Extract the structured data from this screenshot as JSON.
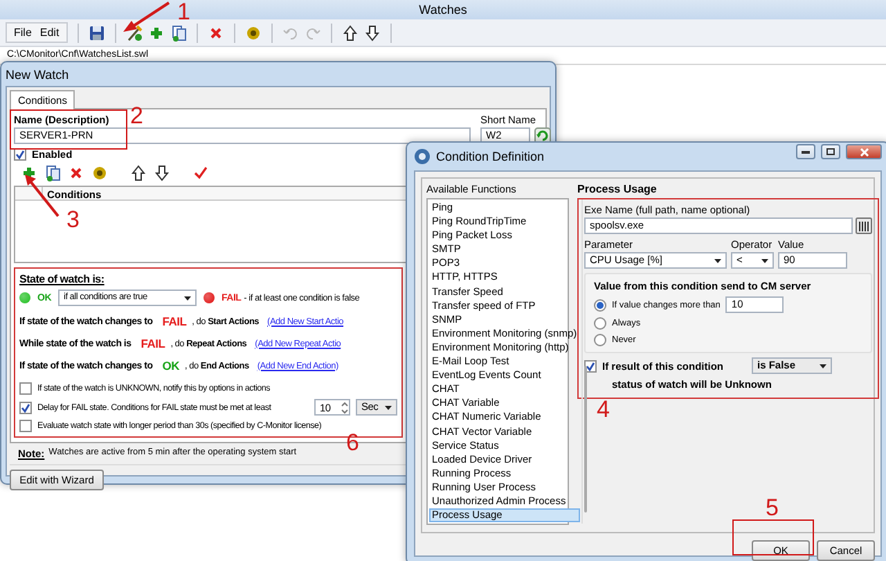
{
  "app": {
    "title": "Watches",
    "menu": [
      "File",
      "Edit"
    ],
    "path": "C:\\CMonitor\\Cnf\\WatchesList.swl"
  },
  "new_watch": {
    "title": "New Watch",
    "tabs": [
      {
        "label": "Conditions",
        "selected": true
      }
    ],
    "name_label": "Name (Description)",
    "name_value": "SERVER1-PRN",
    "short_name_label": "Short Name",
    "short_name_value": "W2",
    "enabled": {
      "label": "Enabled",
      "checked": true
    },
    "table": {
      "columns": [
        "Conditions"
      ]
    },
    "state": {
      "title": "State of watch is:",
      "ok_label": "OK",
      "ok_rule": "if all conditions are true",
      "fail_label": "FAIL",
      "fail_rule": "- if at least one condition is false",
      "actions": [
        {
          "lead": "If state of the watch changes to",
          "state": "FAIL",
          "kind": "fail",
          "tail": ", do **Start Actions**",
          "link": "(Add New Start Actio"
        },
        {
          "lead": "While state of the watch is",
          "state": "FAIL",
          "kind": "fail",
          "tail": ", do **Repeat Actions**",
          "link": "(Add New Repeat Actio"
        },
        {
          "lead": "If state of the watch changes to",
          "state": "OK",
          "kind": "ok",
          "tail": ", do **End Actions**",
          "link": "(Add New End Action)"
        }
      ],
      "options": [
        {
          "label": "If state of the watch is UNKNOWN, notify this by options in actions",
          "checked": false
        },
        {
          "label": "Delay for FAIL state. Conditions for FAIL state must be met at least",
          "checked": true,
          "value": "10",
          "unit": "Sec"
        },
        {
          "label": "Evaluate watch state with longer period than 30s (specified by C-Monitor license)",
          "checked": false
        }
      ]
    },
    "note_label": "Note:",
    "note_text": "Watches are active from 5 min after the operating system start",
    "wizard_button": "Edit with Wizard"
  },
  "condition": {
    "title": "Condition Definition",
    "functions_label": "Available Functions",
    "functions": [
      {
        "label": "Ping",
        "selected": false
      },
      {
        "label": "Ping RoundTripTime",
        "selected": false
      },
      {
        "label": "Ping Packet Loss",
        "selected": false
      },
      {
        "label": "SMTP",
        "selected": false
      },
      {
        "label": "POP3",
        "selected": false
      },
      {
        "label": "HTTP, HTTPS",
        "selected": false
      },
      {
        "label": "Transfer Speed",
        "selected": false
      },
      {
        "label": "Transfer speed of FTP",
        "selected": false
      },
      {
        "label": "SNMP",
        "selected": false
      },
      {
        "label": "Environment Monitoring (snmp)",
        "selected": false
      },
      {
        "label": "Environment Monitoring (http)",
        "selected": false
      },
      {
        "label": "E-Mail Loop Test",
        "selected": false
      },
      {
        "label": "EventLog Events Count",
        "selected": false
      },
      {
        "label": "CHAT",
        "selected": false
      },
      {
        "label": "CHAT Variable",
        "selected": false
      },
      {
        "label": "CHAT Numeric Variable",
        "selected": false
      },
      {
        "label": "CHAT Vector Variable",
        "selected": false
      },
      {
        "label": "Service Status",
        "selected": false
      },
      {
        "label": "Loaded Device Driver",
        "selected": false
      },
      {
        "label": "Running Process",
        "selected": false
      },
      {
        "label": "Running User Process",
        "selected": false
      },
      {
        "label": "Unauthorized Admin Process",
        "selected": false
      },
      {
        "label": "Process Usage",
        "selected": true
      }
    ],
    "section_title": "Process Usage",
    "exe_label": "Exe Name (full path, name optional)",
    "exe_value": "spoolsv.exe",
    "parameter_label": "Parameter",
    "parameter_value": "CPU Usage [%]",
    "operator_label": "Operator",
    "operator_value": "<",
    "value_label": "Value",
    "value_value": "90",
    "send_title": "Value from this condition send to CM server",
    "send_options": [
      {
        "label": "If value changes more than",
        "selected": true,
        "value": "10"
      },
      {
        "label": "Always",
        "selected": false
      },
      {
        "label": "Never",
        "selected": false
      }
    ],
    "unknown": {
      "checked": true,
      "label": "If result of this condition",
      "select": "is False",
      "tail": "status of watch will be Unknown"
    },
    "buttons": [
      "OK",
      "Cancel"
    ]
  },
  "annotations": [
    {
      "label": "1"
    },
    {
      "label": "2"
    },
    {
      "label": "3"
    },
    {
      "label": "4"
    },
    {
      "label": "5"
    },
    {
      "label": "6"
    }
  ]
}
